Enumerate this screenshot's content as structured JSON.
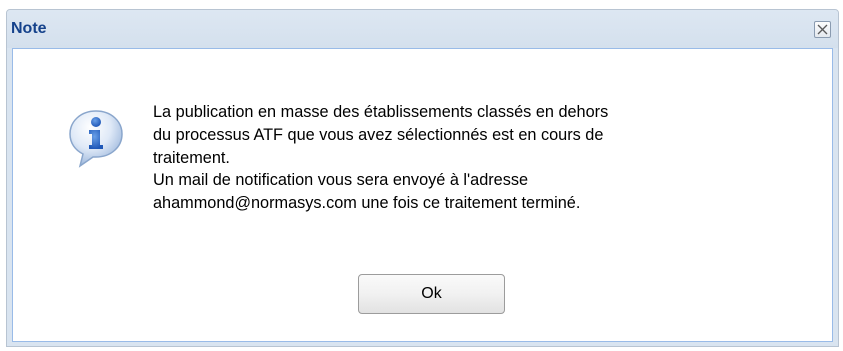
{
  "dialog": {
    "title": "Note",
    "close_icon": "close-icon",
    "info_icon": "info-icon",
    "message_lines": [
      "La publication en masse des établissements classés en dehors",
      "du processus ATF que vous avez sélectionnés est en cours de",
      "traitement.",
      "Un mail de notification vous sera envoyé à l'adresse",
      "ahammond@normasys.com une fois ce traitement terminé."
    ],
    "ok_label": "Ok"
  },
  "colors": {
    "title_text": "#15428b",
    "frame": "#d9e4f0",
    "panel_border": "#99bbe8"
  }
}
